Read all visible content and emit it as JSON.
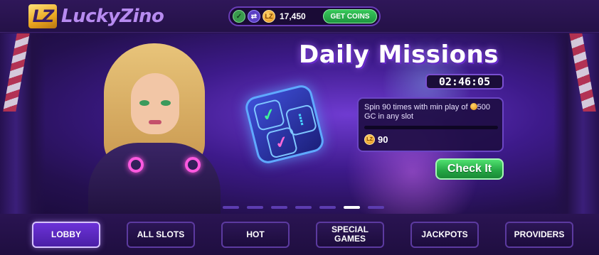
{
  "header": {
    "logo_mark": "LZ",
    "logo_text": "LuckyZino",
    "balance": {
      "sc_icon": "sc-coin-icon",
      "swap_icon": "swap-icon",
      "gc_icon": "gc-coin-icon",
      "gc_symbol": "LZ",
      "amount": "17,450",
      "get_coins_label": "GET COINS"
    }
  },
  "banner": {
    "title": "Daily Missions",
    "timer": "02:46:05",
    "mission": {
      "text_prefix": "Spin 90 times with min play of",
      "text_amount": "500 GC in any slot",
      "progress_fraction": 0,
      "reward_symbol": "LZ",
      "reward_amount": "90"
    },
    "cta_label": "Check It",
    "carousel": {
      "count": 7,
      "active_index": 5
    }
  },
  "nav": {
    "items": [
      {
        "label": "LOBBY",
        "active": true
      },
      {
        "label": "ALL SLOTS",
        "active": false
      },
      {
        "label": "HOT",
        "active": false
      },
      {
        "label": "SPECIAL GAMES",
        "active": false
      },
      {
        "label": "JACKPOTS",
        "active": false
      },
      {
        "label": "PROVIDERS",
        "active": false
      }
    ]
  },
  "colors": {
    "accent_purple": "#6c32d8",
    "cta_green": "#23a543",
    "gold": "#e9a520"
  }
}
